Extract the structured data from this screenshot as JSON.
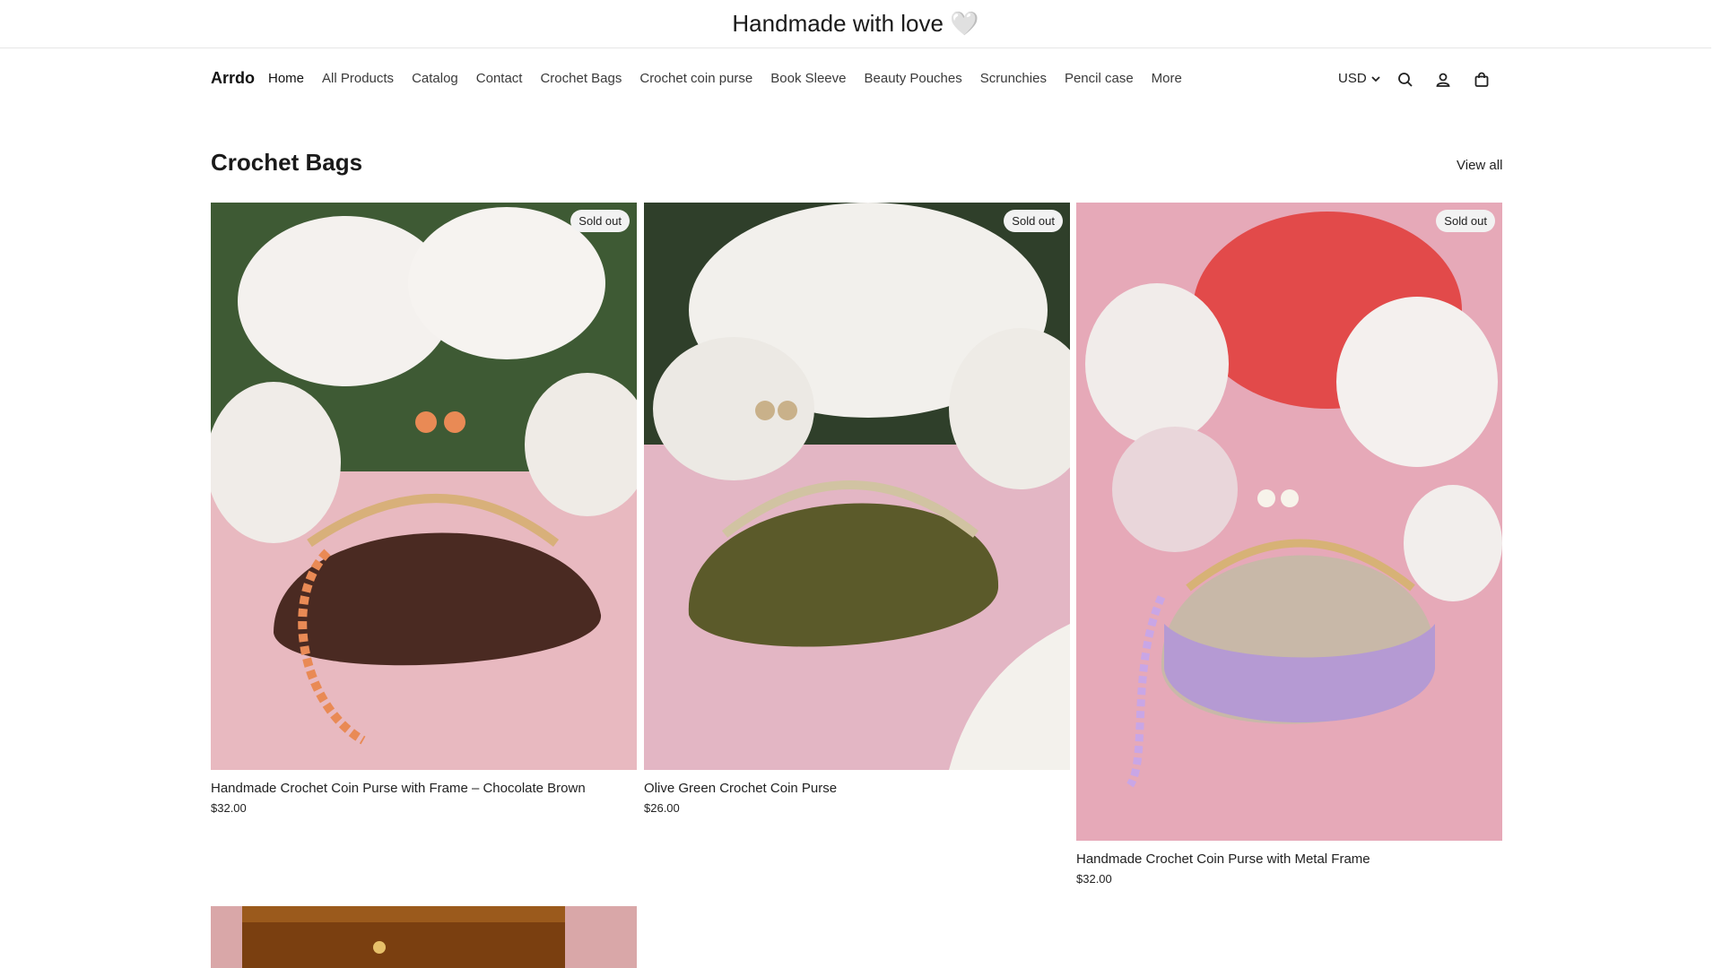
{
  "announcement": "Handmade with love 🤍",
  "header": {
    "brand": "Arrdo",
    "nav": [
      {
        "label": "Home"
      },
      {
        "label": "All Products"
      },
      {
        "label": "Catalog"
      },
      {
        "label": "Contact"
      },
      {
        "label": "Crochet Bags"
      },
      {
        "label": "Crochet coin purse"
      },
      {
        "label": "Book Sleeve"
      },
      {
        "label": "Beauty Pouches"
      },
      {
        "label": "Scrunchies"
      },
      {
        "label": "Pencil case"
      },
      {
        "label": "More"
      }
    ],
    "currency": "USD",
    "icons": [
      "chevron-down-icon",
      "search-icon",
      "account-icon",
      "cart-icon"
    ]
  },
  "section": {
    "title": "Crochet Bags",
    "view_all": "View all"
  },
  "products": [
    {
      "title": "Handmade Crochet Coin Purse with Frame – Chocolate Brown",
      "price": "$32.00",
      "badge": "Sold out",
      "purse_color": "#4a2a22"
    },
    {
      "title": "Olive Green Crochet Coin Purse",
      "price": "$26.00",
      "badge": "Sold out",
      "purse_color": "#5b5a2a"
    },
    {
      "title": "Handmade Crochet Coin Purse with Metal Frame",
      "price": "$32.00",
      "badge": "Sold out",
      "purse_color": "#c8b8a8"
    }
  ],
  "colors": {
    "background": "#ffffff",
    "photo_background": "#e8b9c0",
    "badge_background": "#f2f2f2"
  }
}
